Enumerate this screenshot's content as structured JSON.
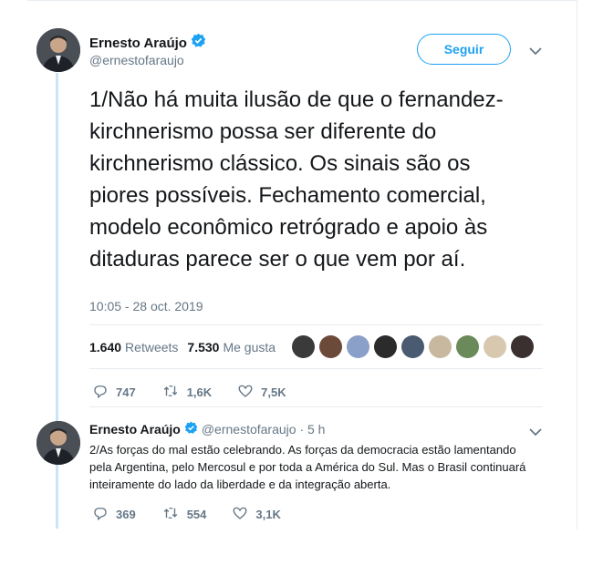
{
  "main_tweet": {
    "author_name": "Ernesto Araújo",
    "handle": "@ernestofaraujo",
    "follow_label": "Seguir",
    "text": "1/Não há muita ilusão de que o fernandez-kirchnerismo possa ser diferente do kirchnerismo clássico. Os sinais são os piores possíveis. Fechamento comercial, modelo econômico retrógrado e apoio às ditaduras parece ser o que vem por aí.",
    "timestamp": "10:05 - 28 oct. 2019",
    "retweets_count": "1.640",
    "retweets_label": "Retweets",
    "likes_count": "7.530",
    "likes_label": "Me gusta",
    "replies": "747",
    "retweets_action": "1,6K",
    "likes_action": "7,5K"
  },
  "likers": [
    "#3a3a3a",
    "#6b4a3a",
    "#8aa0c8",
    "#2b2b2b",
    "#4a5a70",
    "#c8b8a0",
    "#6a8a5a",
    "#d8c8b0",
    "#3a3030"
  ],
  "reply_tweet": {
    "author_name": "Ernesto Araújo",
    "handle_time": "@ernestofaraujo · 5 h",
    "text": "2/As forças do mal estão celebrando. As forças da democracia estão lamentando pela Argentina, pelo Mercosul e por toda a América do Sul. Mas o Brasil continuará inteiramente do lado da liberdade e da integração aberta.",
    "replies": "369",
    "retweets": "554",
    "likes": "3,1K"
  },
  "colors": {
    "accent": "#1da1f2",
    "thread_line": "#cce4f7",
    "muted": "#657786"
  },
  "icons": [
    "verified-badge-icon",
    "chevron-down-icon",
    "reply-icon",
    "retweet-icon",
    "heart-icon"
  ]
}
